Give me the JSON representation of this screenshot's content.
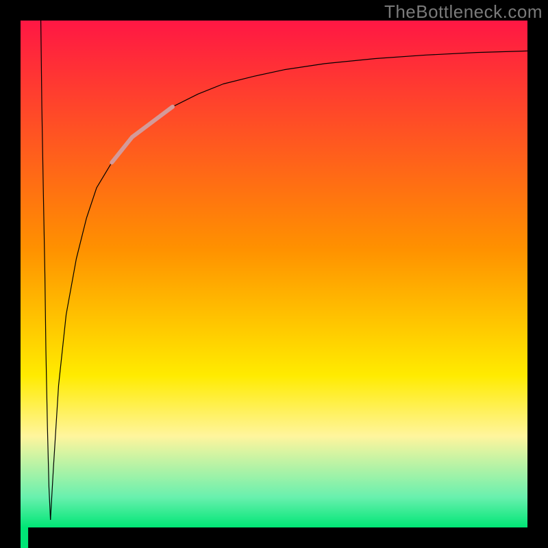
{
  "watermark": "TheBottleneck.com",
  "chart_data": {
    "type": "line",
    "title": "",
    "xlabel": "",
    "ylabel": "",
    "xlim": [
      0,
      100
    ],
    "ylim": [
      0,
      100
    ],
    "grid": false,
    "legend": false,
    "background_gradient": {
      "stops": [
        {
          "offset": 0.0,
          "color": "#ff1744"
        },
        {
          "offset": 0.45,
          "color": "#ff9100"
        },
        {
          "offset": 0.7,
          "color": "#ffeb00"
        },
        {
          "offset": 0.82,
          "color": "#fff59d"
        },
        {
          "offset": 0.94,
          "color": "#69f0ae"
        },
        {
          "offset": 1.0,
          "color": "#00e676"
        }
      ]
    },
    "series": [
      {
        "name": "envelope-left",
        "color": "#000000",
        "width": 1.2,
        "x": [
          4.0,
          4.2,
          4.5,
          4.8,
          5.0,
          5.3,
          5.6,
          5.9
        ],
        "y": [
          100,
          83,
          66,
          50,
          35,
          20,
          8,
          1.5
        ]
      },
      {
        "name": "main-curve",
        "color": "#000000",
        "width": 1.2,
        "x": [
          5.9,
          6.5,
          7.5,
          9.0,
          11,
          13,
          15,
          18,
          22,
          26,
          30,
          35,
          40,
          46,
          52,
          60,
          70,
          80,
          90,
          100
        ],
        "y": [
          1.5,
          12,
          28,
          42,
          53,
          61,
          67,
          72,
          77,
          80,
          83,
          85.5,
          87.5,
          89,
          90.3,
          91.5,
          92.5,
          93.2,
          93.7,
          94.0
        ]
      },
      {
        "name": "highlight-segment",
        "color": "#d49a99",
        "width": 6,
        "x": [
          18,
          22,
          26,
          30
        ],
        "y": [
          72,
          77,
          80,
          83
        ]
      }
    ],
    "frame": {
      "color": "#000000",
      "thickness_px": 30,
      "notch": {
        "side": "bottom-left",
        "width_frac": 0.015,
        "color": "#00e676"
      }
    }
  }
}
